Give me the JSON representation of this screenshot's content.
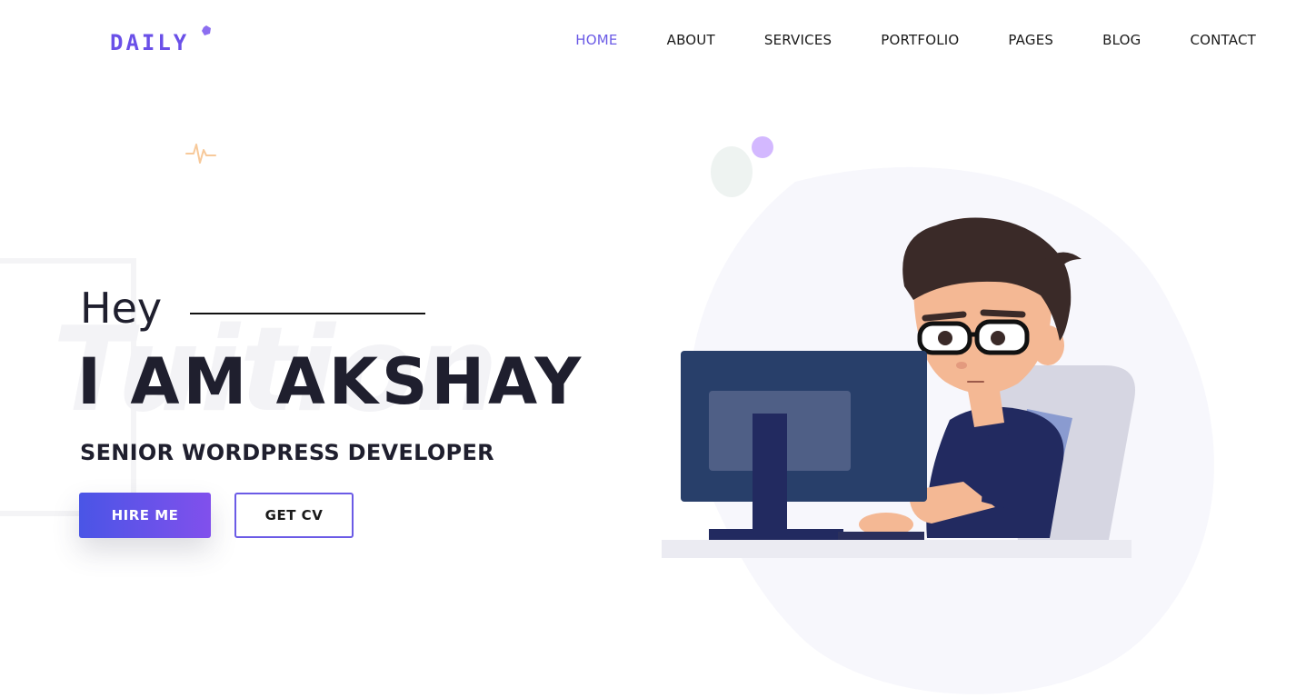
{
  "header": {
    "logo_text": "DAILY",
    "nav": [
      {
        "label": "HOME",
        "active": true
      },
      {
        "label": "ABOUT",
        "active": false
      },
      {
        "label": "SERVICES",
        "active": false
      },
      {
        "label": "PORTFOLIO",
        "active": false
      },
      {
        "label": "PAGES",
        "active": false
      },
      {
        "label": "BLOG",
        "active": false
      },
      {
        "label": "CONTACT",
        "active": false
      }
    ]
  },
  "hero": {
    "greeting": "Hey",
    "headline": "I AM AKSHAY",
    "subtitle": "SENIOR WORDPRESS DEVELOPER",
    "watermark": "Tuition",
    "hire_button": "HIRE ME",
    "cv_button": "GET CV"
  },
  "colors": {
    "accent": "#6b5be6",
    "gradient_start": "#4a55e6",
    "gradient_end": "#8150ec",
    "text": "#1f1f2e"
  },
  "icons": [
    "logo-dot-icon",
    "pulse-icon",
    "developer-illustration"
  ]
}
